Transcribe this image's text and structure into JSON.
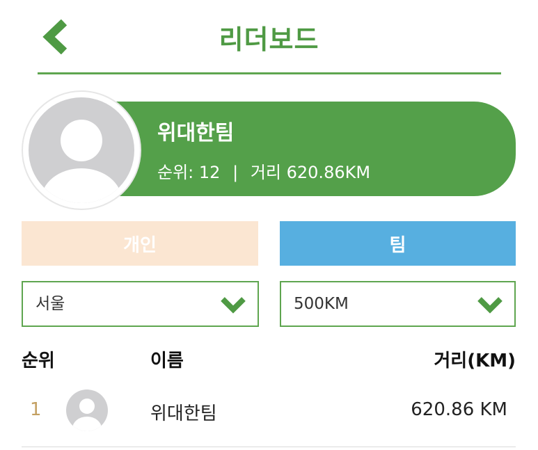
{
  "header": {
    "title": "리더보드",
    "back_icon": "chevron-left-icon"
  },
  "team_card": {
    "name": "위대한팀",
    "rank_label": "순위:",
    "rank_value": "12",
    "separator": "|",
    "distance_label": "거리",
    "distance_value": "620.86KM",
    "avatar_icon": "user-avatar-icon"
  },
  "tabs": {
    "individual": "개인",
    "team": "팀",
    "selected": "team"
  },
  "filters": {
    "region": "서울",
    "distance": "500KM",
    "dropdown_icon": "chevron-down-icon"
  },
  "table": {
    "headers": {
      "rank": "순위",
      "name": "이름",
      "distance": "거리(KM)"
    },
    "rows": [
      {
        "rank": "1",
        "name": "위대한팀",
        "distance": "620.86 KM"
      }
    ]
  },
  "colors": {
    "primary_green": "#54a04a",
    "team_tab_blue": "#57afe0",
    "individual_tab_peach": "#fbe6d2",
    "rank_gold": "#c3a062",
    "avatar_gray": "#cfcfd1"
  }
}
